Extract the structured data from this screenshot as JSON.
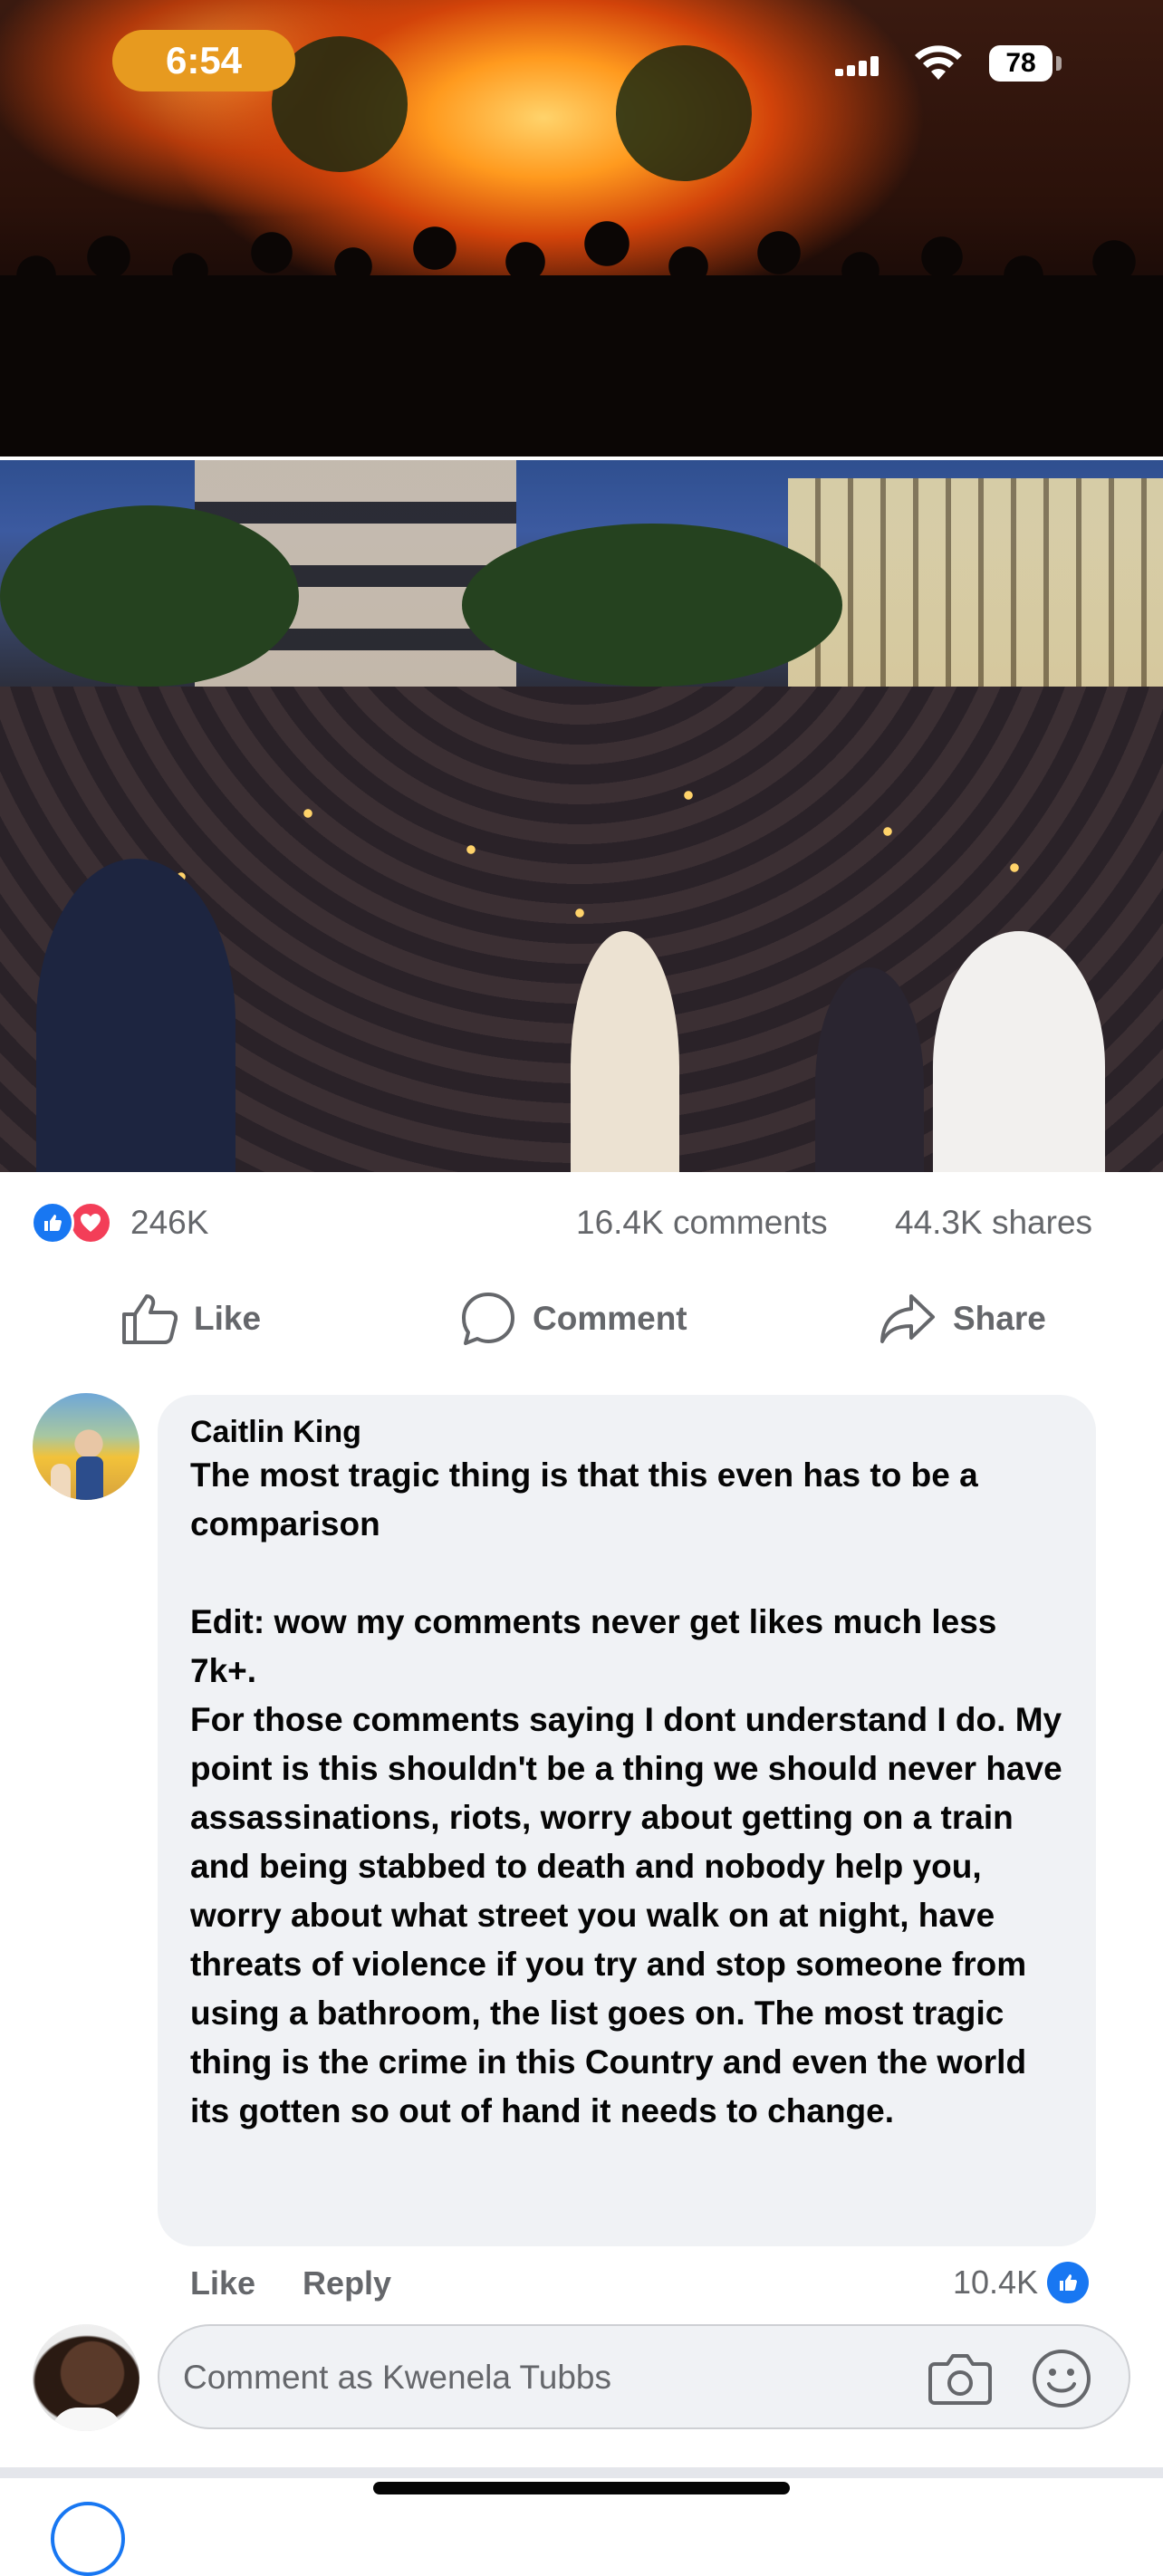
{
  "status_bar": {
    "time": "6:54",
    "battery": "78"
  },
  "post": {
    "reactions_count": "246K",
    "comments_count": "16.4K comments",
    "shares_count": "44.3K shares",
    "actions": {
      "like": "Like",
      "comment": "Comment",
      "share": "Share"
    }
  },
  "comment": {
    "author": "Caitlin King",
    "text": "The most tragic thing is that this even has to be a comparison\n\nEdit: wow my comments never get likes much less 7k+.\nFor those comments saying I dont understand I do.                              My point is this shouldn't be a thing we should never have assassinations, riots, worry about getting on a train and being stabbed to death and nobody help you, worry about what street you walk on at night, have threats of violence if you try and stop someone from using a bathroom, the list goes on. The most tragic thing is the crime in this Country and even the world its gotten so out of hand it needs to change.",
    "like_label": "Like",
    "reply_label": "Reply",
    "likes": "10.4K"
  },
  "composer": {
    "placeholder": "Comment as Kwenela Tubbs"
  },
  "colors": {
    "facebook_blue": "#1877f2",
    "love_red": "#f33e58",
    "time_pill": "#e79a1f"
  },
  "icons": [
    "like-reaction-icon",
    "love-reaction-icon",
    "thumbs-up-icon",
    "comment-icon",
    "share-icon",
    "camera-icon",
    "emoji-icon",
    "wifi-icon",
    "signal-icon"
  ]
}
